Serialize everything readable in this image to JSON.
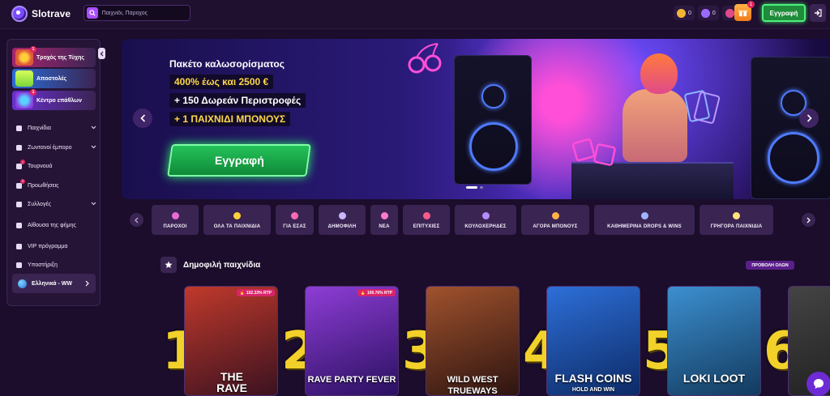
{
  "brand": {
    "name": "Slotrave"
  },
  "search": {
    "placeholder": "Παιχνίδι, Πάροχος"
  },
  "balances": [
    {
      "value": "0",
      "icon": "gold-coin-icon",
      "color": "#f2b634"
    },
    {
      "value": "0",
      "icon": "purple-coin-icon",
      "color": "#9a6bff"
    },
    {
      "value": "0",
      "icon": "bb-coin-icon",
      "color": "#e04a8a"
    }
  ],
  "gift": {
    "badge": "1"
  },
  "header": {
    "register_label": "Εγγραφή"
  },
  "sidebar": {
    "promos": [
      {
        "label": "Τροχός της Τύχης",
        "badge": "1",
        "color": "#a8246f"
      },
      {
        "label": "Αποστολές",
        "badge": "",
        "color": "#2b6ed8"
      },
      {
        "label": "Κέντρο επάθλων",
        "badge": "1",
        "color": "#6a2fd0"
      }
    ],
    "items": [
      {
        "label": "Παιχνίδια",
        "chevron": true,
        "badge": ""
      },
      {
        "label": "Ζωντανοί έμπορο",
        "chevron": true,
        "badge": ""
      },
      {
        "label": "Τουρνουά",
        "chevron": false,
        "badge": "7"
      },
      {
        "label": "Προωθήσεις",
        "chevron": false,
        "badge": "9"
      },
      {
        "label": "Συλλογές",
        "chevron": true,
        "badge": ""
      },
      {
        "label": "Αίθουσα της φήμης",
        "chevron": false,
        "badge": ""
      },
      {
        "label": "VIP πρόγραμμα",
        "chevron": false,
        "badge": ""
      },
      {
        "label": "Υποστήριξη",
        "chevron": false,
        "badge": ""
      }
    ],
    "language": "Ελληνικά - WW"
  },
  "banner": {
    "title": "Πακέτο καλωσορίσματος",
    "line1": "400% έως και 2500 €",
    "line2": "+ 150 Δωρεάν Περιστροφές",
    "line3": "+ 1 ΠΑΙΧΝΙΔΙ ΜΠΟΝΟΥΣ",
    "cta": "Εγγραφή",
    "slide_count": 2,
    "active_slide": 1
  },
  "categories": [
    {
      "label": "ΠΑΡΟΧΟΙ",
      "icon": "flag-icon"
    },
    {
      "label": "ΟΛΑ ΤΑ ΠΑΙΧΝΙΔΙΑ",
      "icon": "coin-icon"
    },
    {
      "label": "ΓΙΑ ΕΣΑΣ",
      "icon": "heart-cards-icon"
    },
    {
      "label": "ΔΗΜΟΦΙΛΗ",
      "icon": "star-icon"
    },
    {
      "label": "ΝΕΑ",
      "icon": "sparkle-icon"
    },
    {
      "label": "ΕΠΙΤΥΧΙΕΣ",
      "icon": "joystick-icon"
    },
    {
      "label": "ΚΟΥΛΟΧΕΡΗΔΕΣ",
      "icon": "slot-machine-icon"
    },
    {
      "label": "ΑΓΟΡΑ ΜΠΟΝΟΥΣ",
      "icon": "bonus-icon"
    },
    {
      "label": "ΚΑΘΗΜΕΡΙΝΑ DROPS & WINS",
      "icon": "trophy-icon"
    },
    {
      "label": "ΓΡΗΓΟΡΑ ΠΑΙΧΝΙΔΙΑ",
      "icon": "rocket-icon"
    }
  ],
  "popular": {
    "title": "Δημοφιλή παιχνίδια",
    "see_all": "ΠΡΟΒΟΛΗ ΟΛΩΝ",
    "games": [
      {
        "rank": "1",
        "title": "THE RAVE",
        "badge": "102.33% RTP",
        "colors": [
          "#c0392b",
          "#3b1220"
        ]
      },
      {
        "rank": "2",
        "title": "RAVE PARTY FEVER",
        "badge": "109.76% RTP",
        "colors": [
          "#8e3dd6",
          "#2a1060"
        ]
      },
      {
        "rank": "3",
        "title": "WILD WEST TRUEWAYS",
        "badge": "",
        "colors": [
          "#a0522d",
          "#2d1410"
        ]
      },
      {
        "rank": "4",
        "title": "FLASH COINS",
        "subtitle": "HOLD AND WIN",
        "badge": "",
        "colors": [
          "#2d6fd8",
          "#0d2a66"
        ]
      },
      {
        "rank": "5",
        "title": "LOKI LOOT",
        "badge": "",
        "colors": [
          "#3c8fd0",
          "#123a5e"
        ]
      },
      {
        "rank": "6",
        "title": "",
        "badge": "",
        "colors": [
          "#444",
          "#222"
        ]
      }
    ]
  }
}
